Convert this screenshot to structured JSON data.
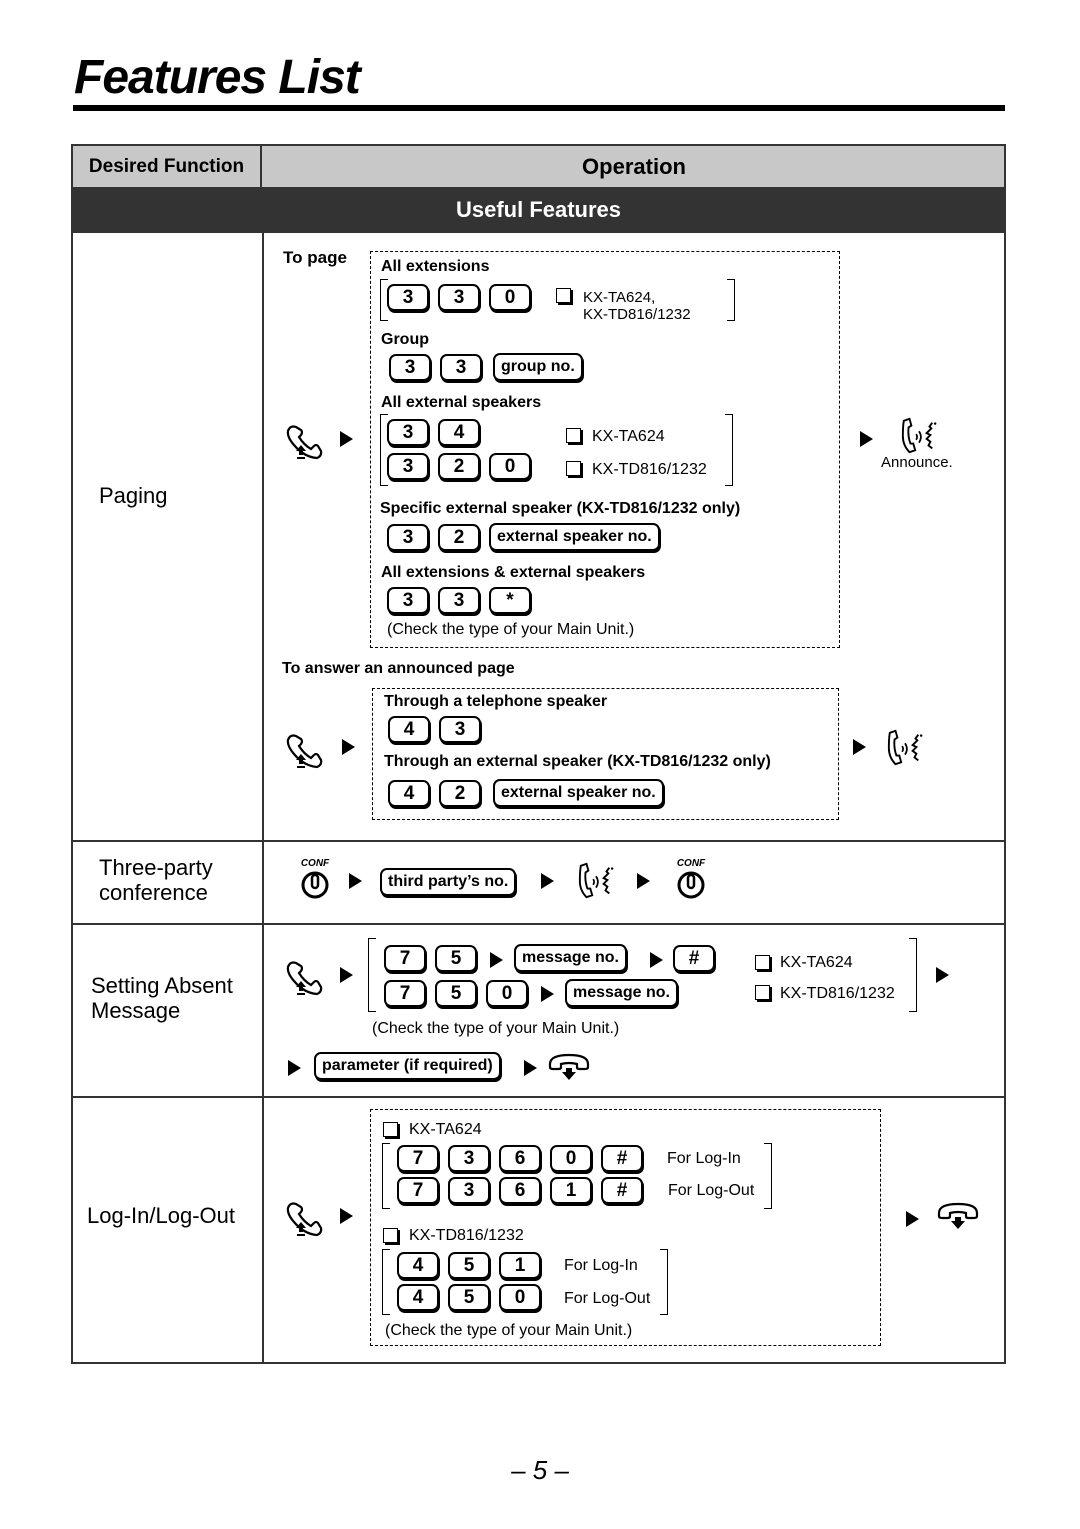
{
  "page": {
    "title": "Features List",
    "page_number": "– 5 –"
  },
  "table": {
    "header": {
      "desired_function": "Desired Function",
      "operation": "Operation"
    },
    "section_band": "Useful Features"
  },
  "paging": {
    "function_label": "Paging",
    "to_page_label": "To page",
    "all_extensions": {
      "label": "All extensions",
      "keys": [
        "3",
        "3",
        "0"
      ],
      "models_line1": "KX-TA624,",
      "models_line2": "KX-TD816/1232"
    },
    "group": {
      "label": "Group",
      "keys": [
        "3",
        "3"
      ],
      "param": "group no."
    },
    "all_external_speakers": {
      "label": "All external speakers",
      "row1_keys": [
        "3",
        "4"
      ],
      "row1_model": "KX-TA624",
      "row2_keys": [
        "3",
        "2",
        "0"
      ],
      "row2_model": "KX-TD816/1232"
    },
    "specific_external_speaker": {
      "label_prefix": "Specific external speaker",
      "label_suffix": "(KX-TD816/1232 only)",
      "keys": [
        "3",
        "2"
      ],
      "param": "external speaker no."
    },
    "all_ext_and_speakers": {
      "label": "All extensions & external speakers",
      "keys": [
        "3",
        "3",
        "*"
      ]
    },
    "check_note": "(Check the type of your Main Unit.)",
    "announce_label": "Announce.",
    "answer": {
      "label": "To answer an announced page",
      "telephone_speaker": {
        "label": "Through a telephone speaker",
        "keys": [
          "4",
          "3"
        ]
      },
      "external_speaker": {
        "label_prefix": "Through an external speaker",
        "label_suffix": "(KX-TD816/1232 only)",
        "keys": [
          "4",
          "2"
        ],
        "param": "external speaker no."
      }
    }
  },
  "three_party": {
    "function_line1": "Three-party",
    "function_line2": "conference",
    "conf_label": "CONF",
    "param": "third party’s no."
  },
  "absent_message": {
    "function_line1": "Setting Absent",
    "function_line2": "Message",
    "row1_keys": [
      "7",
      "5"
    ],
    "row1_param": "message no.",
    "row1_end_key": "#",
    "row1_model": "KX-TA624",
    "row2_keys": [
      "7",
      "5",
      "0"
    ],
    "row2_param": "message no.",
    "row2_model": "KX-TD816/1232",
    "check_note": "(Check the type of your Main Unit.)",
    "param2": "parameter (if required)"
  },
  "login_logout": {
    "function_label": "Log-In/Log-Out",
    "ta624": {
      "model": "KX-TA624",
      "login_keys": [
        "7",
        "3",
        "6",
        "0",
        "#"
      ],
      "logout_keys": [
        "7",
        "3",
        "6",
        "1",
        "#"
      ],
      "login_label": "For Log-In",
      "logout_label": "For Log-Out"
    },
    "td816": {
      "model": "KX-TD816/1232",
      "login_keys": [
        "4",
        "5",
        "1"
      ],
      "logout_keys": [
        "4",
        "5",
        "0"
      ],
      "login_label": "For Log-In",
      "logout_label": "For Log-Out"
    },
    "check_note": "(Check the type of your Main Unit.)"
  },
  "icons": {
    "off_hook": "off-hook-handset-icon",
    "on_hook": "on-hook-handset-icon",
    "talk": "talk-icon",
    "conf_button": "conf-button-icon",
    "arrow": "play-arrow-icon",
    "checkbox": "checkbox-icon"
  }
}
